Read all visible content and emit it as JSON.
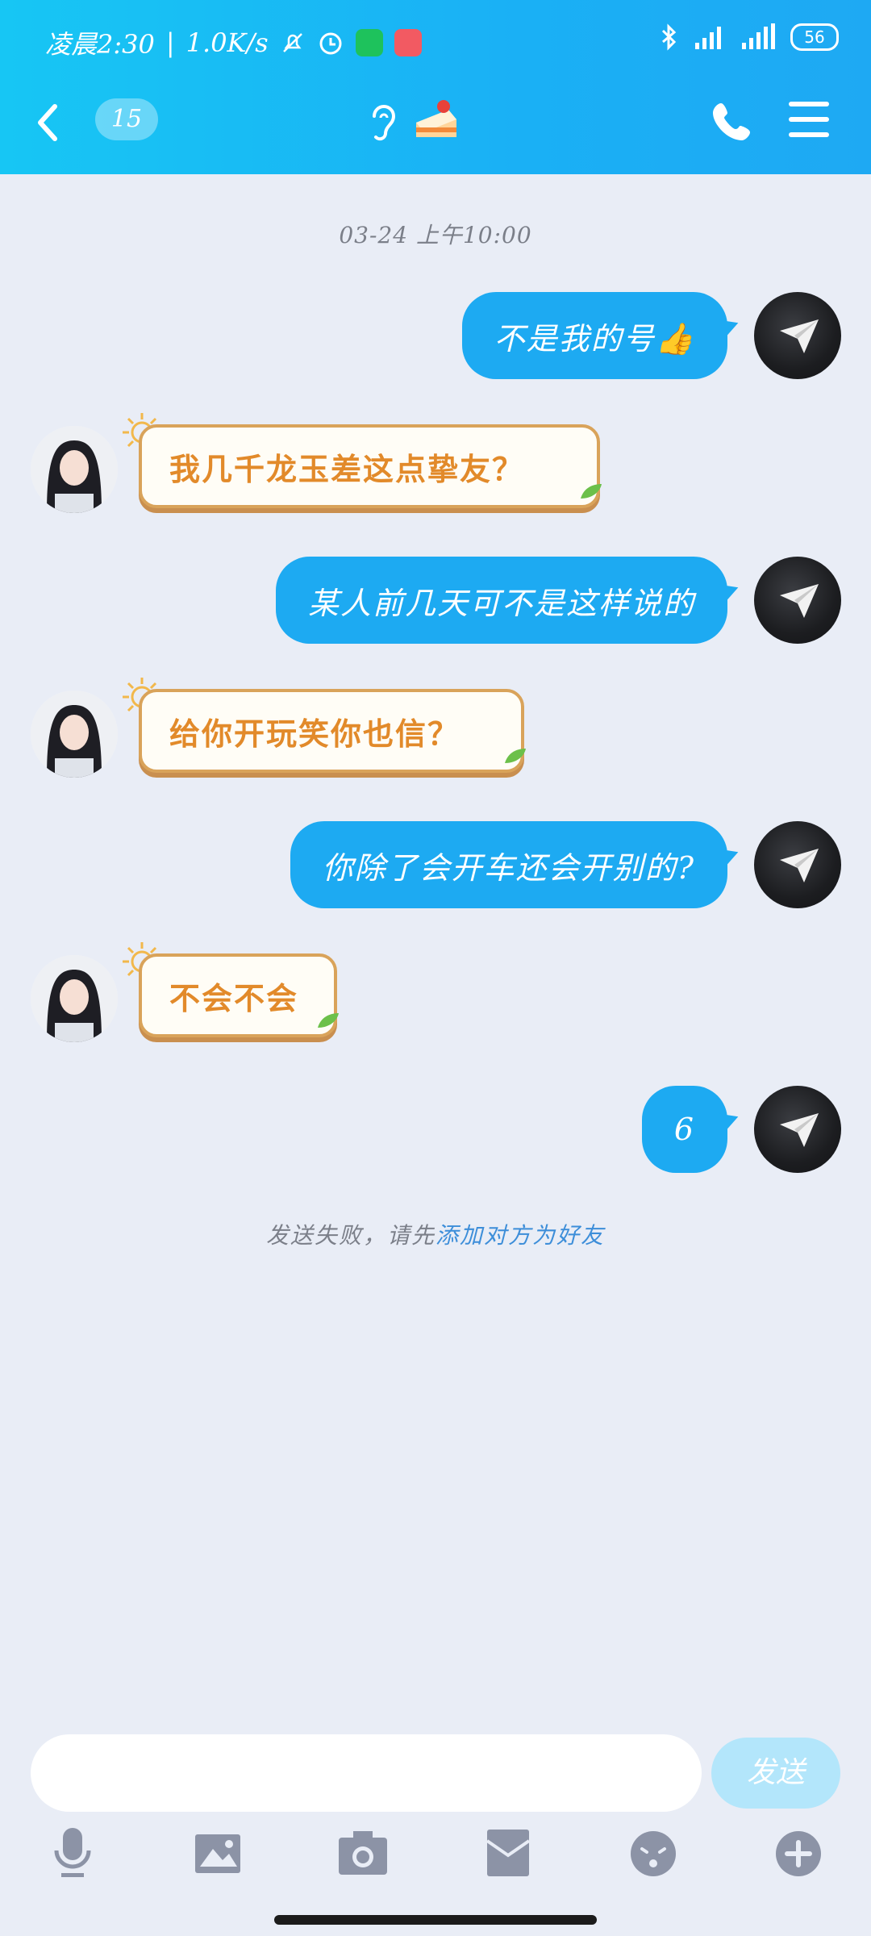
{
  "status_bar": {
    "time_text": "凌晨2:30",
    "separator": "|",
    "speed": "1.0K/s",
    "battery": "56"
  },
  "nav": {
    "unread_count": "15"
  },
  "chat": {
    "timestamp": "03-24 上午10:00",
    "messages": [
      {
        "side": "out",
        "text": "不是我的号👍"
      },
      {
        "side": "in",
        "text": "我几千龙玉差这点挚友？"
      },
      {
        "side": "out",
        "text": "某人前几天可不是这样说的"
      },
      {
        "side": "in",
        "text": "给你开玩笑你也信？"
      },
      {
        "side": "out",
        "text": "你除了会开车还会开别的?"
      },
      {
        "side": "in",
        "text": "不会不会"
      },
      {
        "side": "out",
        "text": "6"
      }
    ],
    "fail_notice": "发送失败，请先",
    "fail_link": "添加对方为好友"
  },
  "input": {
    "send_label": "发送"
  },
  "colors": {
    "header": "#1ab0f5",
    "outgoing_bubble": "#1daaf2",
    "incoming_text": "#e28a2a",
    "link": "#3d8ed9"
  },
  "icons": [
    "back-icon",
    "ear-icon",
    "cake-icon",
    "phone-icon",
    "menu-icon",
    "mic-icon",
    "image-icon",
    "camera-icon",
    "redpacket-icon",
    "emoji-icon",
    "plus-icon"
  ]
}
